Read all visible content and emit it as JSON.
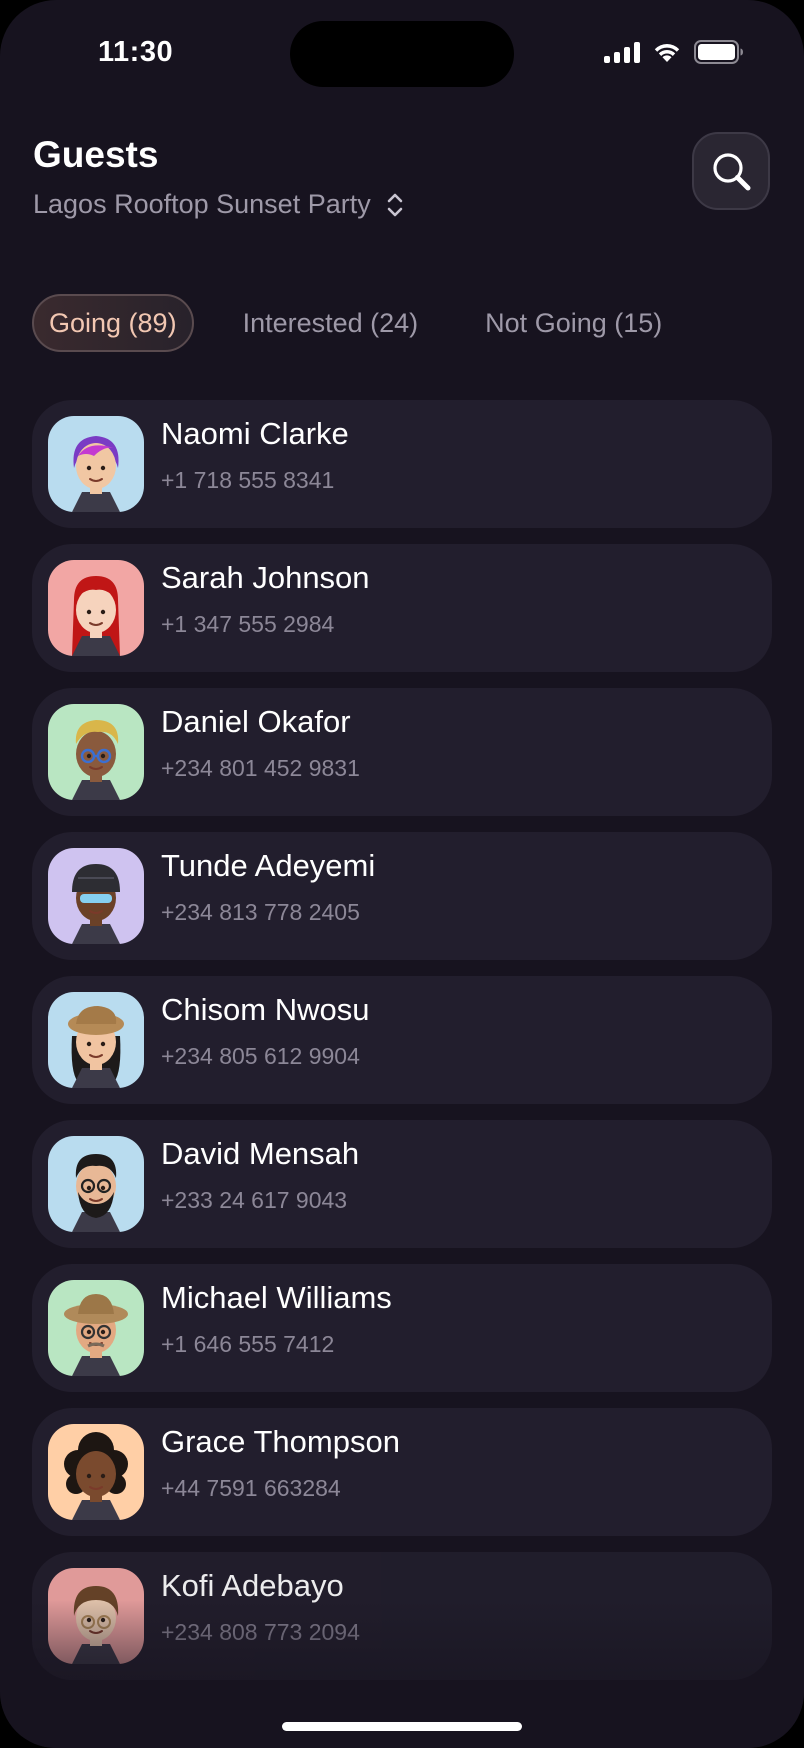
{
  "status_bar": {
    "time": "11:30"
  },
  "header": {
    "title": "Guests",
    "event_name": "Lagos Rooftop Sunset Party",
    "event_selector_icon": "chevron-up-down-icon",
    "search_icon": "search-icon"
  },
  "tabs": [
    {
      "label": "Going (89)",
      "active": true
    },
    {
      "label": "Interested (24)",
      "active": false
    },
    {
      "label": "Not Going (15)",
      "active": false
    }
  ],
  "guests": [
    {
      "name": "Naomi Clarke",
      "phone": "+1 718 555 8341",
      "avatar_bg": "#b9dcef",
      "skin": "#f1c7a3",
      "hair": "#7a3bc4",
      "hair_style": "pixie"
    },
    {
      "name": "Sarah Johnson",
      "phone": "+1 347 555 2984",
      "avatar_bg": "#f2a6a4",
      "skin": "#f6d3bd",
      "hair": "#c01616",
      "hair_style": "long"
    },
    {
      "name": "Daniel Okafor",
      "phone": "+234 801 452 9831",
      "avatar_bg": "#b9e6c2",
      "skin": "#8a5a3d",
      "hair": "#d9b64a",
      "hair_style": "short-glasses"
    },
    {
      "name": "Tunde Adeyemi",
      "phone": "+234 813 778 2405",
      "avatar_bg": "#cfc3f0",
      "skin": "#6b4128",
      "hair": "#2d2d33",
      "hair_style": "helmet"
    },
    {
      "name": "Chisom Nwosu",
      "phone": "+234 805 612 9904",
      "avatar_bg": "#b9dcef",
      "skin": "#f1c4a1",
      "hair": "#1d1a1a",
      "hair_style": "hat"
    },
    {
      "name": "David Mensah",
      "phone": "+233 24 617 9043",
      "avatar_bg": "#b9dcef",
      "skin": "#e8b896",
      "hair": "#1d1a1a",
      "hair_style": "beard-glasses"
    },
    {
      "name": "Michael Williams",
      "phone": "+1 646 555 7412",
      "avatar_bg": "#b9e6c2",
      "skin": "#e3a982",
      "hair": "#b08a5a",
      "hair_style": "hat-glasses"
    },
    {
      "name": "Grace Thompson",
      "phone": "+44 7591 663284",
      "avatar_bg": "#ffcfa6",
      "skin": "#7a4a2e",
      "hair": "#1d1612",
      "hair_style": "curly"
    },
    {
      "name": "Kofi Adebayo",
      "phone": "+234 808 773 2094",
      "avatar_bg": "#f2a6a4",
      "skin": "#f1d0b6",
      "hair": "#6b4528",
      "hair_style": "bowl-glasses"
    }
  ]
}
